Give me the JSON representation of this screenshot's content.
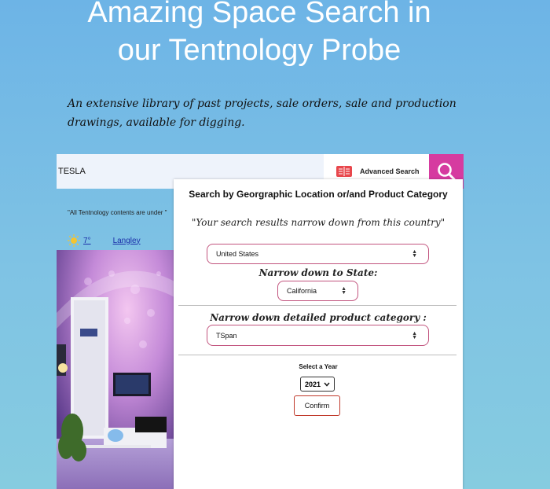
{
  "hero": {
    "title_line1": "Amazing Space Search in",
    "title_line2": "our Tentnology Probe",
    "subtitle": "An extensive library of past projects, sale orders, sale and production drawings, available for digging."
  },
  "search": {
    "value": "TESLA",
    "advanced_label": "Advanced Search",
    "icons": {
      "advanced": "book-icon",
      "submit": "magnifier-icon"
    },
    "accent_color": "#d63ba0"
  },
  "notice": "\"All Tentnology contents are under \"",
  "weather": {
    "icon": "sun-icon",
    "temp": "7°",
    "city": "Langley"
  },
  "panel": {
    "title": "Search by Georgraphic Location or/and Product Category",
    "country_prompt": "\"Your search results narrow down from this country\"",
    "country": "United States",
    "state_prompt": "Narrow down to State:",
    "state": "California",
    "category_prompt": "Narrow down detailed product category :",
    "category": "TSpan",
    "year_label": "Select a Year",
    "year": "2021",
    "confirm_label": "Confirm",
    "border_color": "#c2547e"
  }
}
